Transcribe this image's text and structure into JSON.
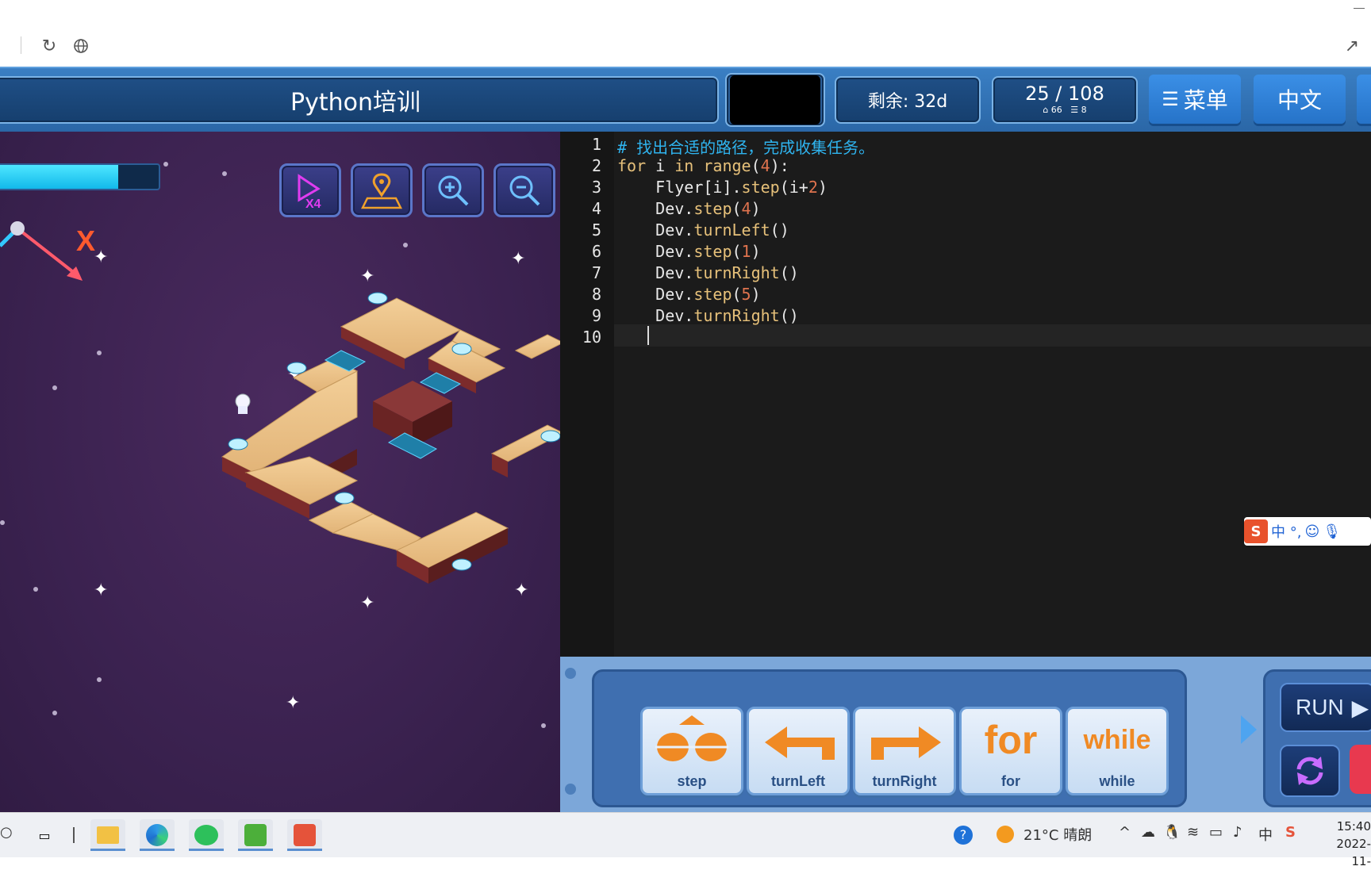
{
  "browser": {
    "reload_icon": "reload-icon",
    "globe_icon": "globe-icon",
    "share_icon": "share-icon"
  },
  "header": {
    "title": "Python培训",
    "remaining": "剩余: 32d",
    "progress": "25 / 108",
    "stat_a": "66",
    "stat_b": "8",
    "menu_label": "菜单",
    "lang_label": "中文"
  },
  "game": {
    "energy_fraction": 0.75,
    "axis_label": "X",
    "tools": [
      "speed-x4-button",
      "map-button",
      "zoom-in-button",
      "zoom-out-button"
    ],
    "speed_label": "X4"
  },
  "editor": {
    "lines": [
      {
        "n": "1",
        "code": "# 找出合适的路径，完成收集任务。"
      },
      {
        "n": "2",
        "code": "for i in range(4):"
      },
      {
        "n": "3",
        "code": "    Flyer[i].step(i+2)"
      },
      {
        "n": "4",
        "code": "    Dev.step(4)"
      },
      {
        "n": "5",
        "code": "    Dev.turnLeft()"
      },
      {
        "n": "6",
        "code": "    Dev.step(1)"
      },
      {
        "n": "7",
        "code": "    Dev.turnRight()"
      },
      {
        "n": "8",
        "code": "    Dev.step(5)"
      },
      {
        "n": "9",
        "code": "    Dev.turnRight()"
      },
      {
        "n": "10",
        "code": ""
      }
    ]
  },
  "palette": {
    "blocks": [
      {
        "label": "step"
      },
      {
        "label": "turnLeft"
      },
      {
        "label": "turnRight"
      },
      {
        "label": "for",
        "big": "for"
      },
      {
        "label": "while",
        "big": "while"
      }
    ],
    "run_label": "RUN"
  },
  "ime": {
    "label": "中 °,"
  },
  "taskbar": {
    "weather": "21°C 晴朗",
    "time": "15:40",
    "date": "2022-11-",
    "ime_indicator": "中"
  }
}
